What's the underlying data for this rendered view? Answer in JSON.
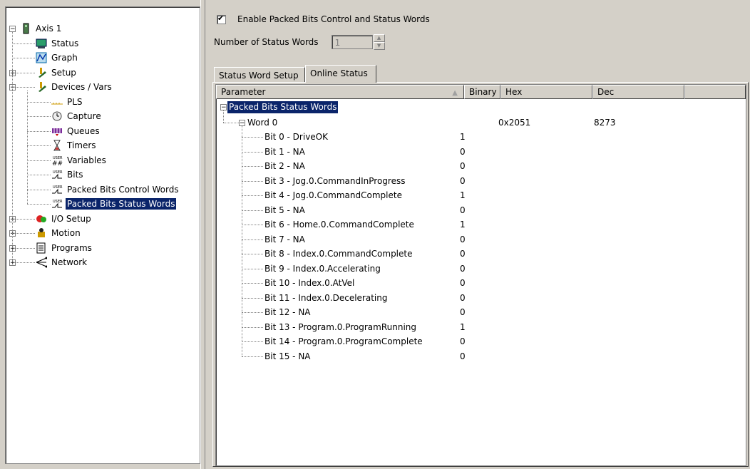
{
  "tree": [
    {
      "label": "Axis 1",
      "icon": "drive-icon",
      "expander": "minus"
    },
    {
      "label": "Status",
      "icon": "status-monitor-icon",
      "expander": ""
    },
    {
      "label": "Graph",
      "icon": "graph-icon",
      "expander": ""
    },
    {
      "label": "Setup",
      "icon": "setup-tools-icon",
      "expander": "plus"
    },
    {
      "label": "Devices / Vars",
      "icon": "devices-tools-icon",
      "expander": "minus"
    },
    {
      "label": "PLS",
      "icon": "pls-icon",
      "expander": ""
    },
    {
      "label": "Capture",
      "icon": "clock-icon",
      "expander": ""
    },
    {
      "label": "Queues",
      "icon": "queue-icon",
      "expander": ""
    },
    {
      "label": "Timers",
      "icon": "hourglass-icon",
      "expander": ""
    },
    {
      "label": "Variables",
      "icon": "user-variables-icon",
      "expander": ""
    },
    {
      "label": "Bits",
      "icon": "user-bits-icon",
      "expander": ""
    },
    {
      "label": "Packed Bits Control Words",
      "icon": "user-bits-icon",
      "expander": ""
    },
    {
      "label": "Packed Bits Status Words",
      "icon": "user-bits-icon",
      "expander": "",
      "selected": true
    },
    {
      "label": "I/O Setup",
      "icon": "io-setup-icon",
      "expander": "plus"
    },
    {
      "label": "Motion",
      "icon": "motion-icon",
      "expander": "plus"
    },
    {
      "label": "Programs",
      "icon": "programs-icon",
      "expander": "plus"
    },
    {
      "label": "Network",
      "icon": "network-icon",
      "expander": "plus"
    }
  ],
  "enable_label": "Enable Packed Bits Control and Status Words",
  "enable_checked": true,
  "num_status_words_label": "Number of Status Words",
  "num_status_words_value": "1",
  "tabs": [
    "Status Word Setup",
    "Online Status"
  ],
  "active_tab": "Online Status",
  "columns": [
    "Parameter",
    "Binary",
    "Hex",
    "Dec"
  ],
  "group_label": "Packed Bits Status Words",
  "word": {
    "label": "Word 0",
    "hex": "0x2051",
    "dec": "8273"
  },
  "bits": [
    {
      "label": "Bit 0 - DriveOK",
      "binary": "1"
    },
    {
      "label": "Bit 1 - NA",
      "binary": "0"
    },
    {
      "label": "Bit 2 - NA",
      "binary": "0"
    },
    {
      "label": "Bit 3 - Jog.0.CommandInProgress",
      "binary": "0"
    },
    {
      "label": "Bit 4 - Jog.0.CommandComplete",
      "binary": "1"
    },
    {
      "label": "Bit 5 - NA",
      "binary": "0"
    },
    {
      "label": "Bit 6 - Home.0.CommandComplete",
      "binary": "1"
    },
    {
      "label": "Bit 7 - NA",
      "binary": "0"
    },
    {
      "label": "Bit 8 - Index.0.CommandComplete",
      "binary": "0"
    },
    {
      "label": "Bit 9 - Index.0.Accelerating",
      "binary": "0"
    },
    {
      "label": "Bit 10 - Index.0.AtVel",
      "binary": "0"
    },
    {
      "label": "Bit 11 - Index.0.Decelerating",
      "binary": "0"
    },
    {
      "label": "Bit 12 - NA",
      "binary": "0"
    },
    {
      "label": "Bit 13 - Program.0.ProgramRunning",
      "binary": "1"
    },
    {
      "label": "Bit 14 - Program.0.ProgramComplete",
      "binary": "0"
    },
    {
      "label": "Bit 15 - NA",
      "binary": "0"
    }
  ]
}
